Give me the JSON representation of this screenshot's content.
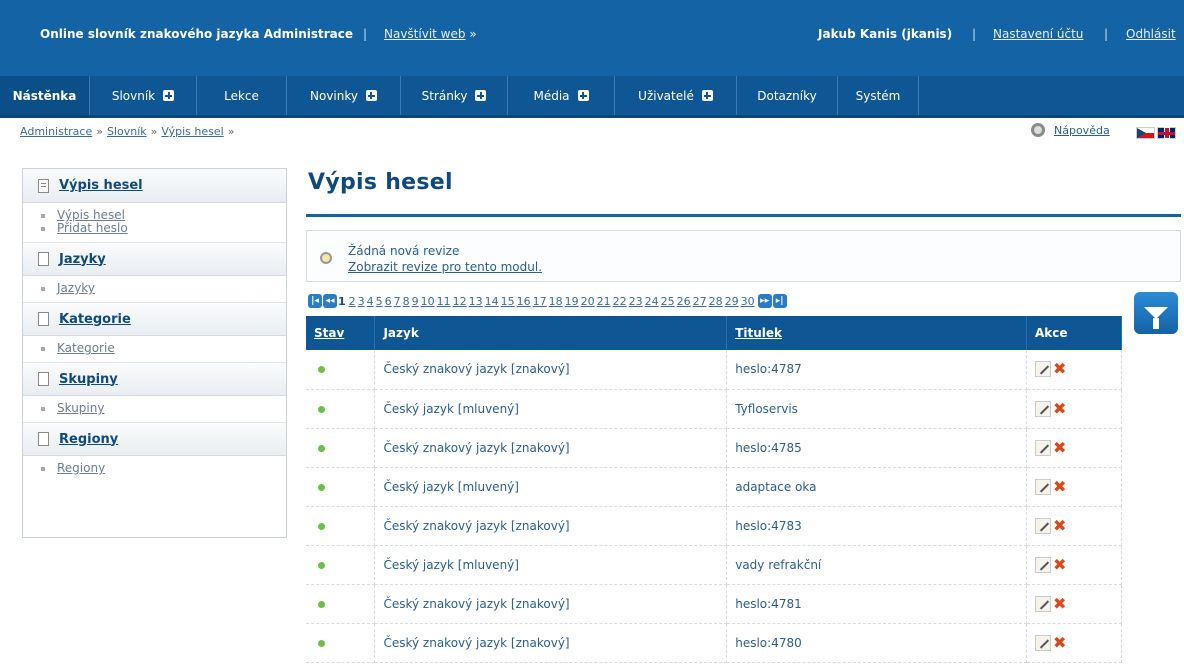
{
  "topbar": {
    "site_title": "Online slovník znakového jazyka Administrace",
    "separator": "|",
    "visit_label": "Navštívit web",
    "visit_arrow": "»",
    "user": "Jakub Kanis (jkanis)",
    "settings_label": "Nastavení účtu",
    "logout_label": "Odhlásit"
  },
  "nav": [
    {
      "label": "Nástěnka",
      "plus": false,
      "active": true
    },
    {
      "label": "Slovník",
      "plus": true,
      "active": false
    },
    {
      "label": "Lekce",
      "plus": false,
      "active": false
    },
    {
      "label": "Novinky",
      "plus": true,
      "active": false
    },
    {
      "label": "Stránky",
      "plus": true,
      "active": false
    },
    {
      "label": "Média",
      "plus": true,
      "active": false
    },
    {
      "label": "Uživatelé",
      "plus": true,
      "active": false
    },
    {
      "label": "Dotazníky",
      "plus": false,
      "active": false
    },
    {
      "label": "Systém",
      "plus": false,
      "active": false
    }
  ],
  "breadcrumb": {
    "items": [
      "Administrace",
      "Slovník",
      "Výpis hesel"
    ],
    "separator": "»"
  },
  "help": {
    "label": "Nápověda"
  },
  "sidebar": {
    "sections": [
      {
        "title": "Výpis hesel",
        "icon": "list-document-icon",
        "items": [
          "Výpis hesel",
          "Přidat heslo"
        ]
      },
      {
        "title": "Jazyky",
        "icon": "document-icon",
        "items": [
          "Jazyky"
        ]
      },
      {
        "title": "Kategorie",
        "icon": "document-icon",
        "items": [
          "Kategorie"
        ]
      },
      {
        "title": "Skupiny",
        "icon": "document-icon",
        "items": [
          "Skupiny"
        ]
      },
      {
        "title": "Regiony",
        "icon": "document-icon",
        "items": [
          "Regiony"
        ]
      }
    ]
  },
  "main": {
    "title": "Výpis hesel",
    "revision": {
      "message": "Žádná nová revize",
      "link": "Zobrazit revize pro tento modul."
    },
    "pager": {
      "current": "1",
      "pages": [
        "2",
        "3",
        "4",
        "5",
        "6",
        "7",
        "8",
        "9",
        "10",
        "11",
        "12",
        "13",
        "14",
        "15",
        "16",
        "17",
        "18",
        "19",
        "20",
        "21",
        "22",
        "23",
        "24",
        "25",
        "26",
        "27",
        "28",
        "29",
        "30"
      ]
    },
    "table": {
      "headers": {
        "status": "Stav",
        "language": "Jazyk",
        "title": "Titulek",
        "actions": "Akce"
      },
      "rows": [
        {
          "language": "Český znakový jazyk [znakový]",
          "title": "heslo:4787"
        },
        {
          "language": "Český jazyk [mluvený]",
          "title": "Tyfloservis"
        },
        {
          "language": "Český znakový jazyk [znakový]",
          "title": "heslo:4785"
        },
        {
          "language": "Český jazyk [mluvený]",
          "title": "adaptace oka"
        },
        {
          "language": "Český znakový jazyk [znakový]",
          "title": "heslo:4783"
        },
        {
          "language": "Český jazyk [mluvený]",
          "title": "vady refrakční"
        },
        {
          "language": "Český znakový jazyk [znakový]",
          "title": "heslo:4781"
        },
        {
          "language": "Český znakový jazyk [znakový]",
          "title": "heslo:4780"
        }
      ]
    }
  },
  "colors": {
    "topbar": "#1463a5",
    "nav": "#0f5794",
    "status_active": "#6cc04a",
    "delete": "#d94a1b"
  }
}
